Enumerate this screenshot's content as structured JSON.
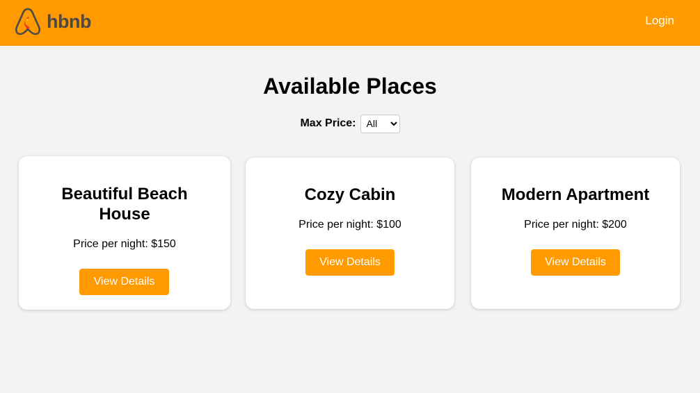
{
  "header": {
    "logo_text": "hbnb",
    "login_label": "Login"
  },
  "main": {
    "title": "Available Places",
    "filter": {
      "label": "Max Price:",
      "selected": "All"
    },
    "places": [
      {
        "name": "Beautiful Beach House",
        "price_text": "Price per night: $150",
        "button_label": "View Details"
      },
      {
        "name": "Cozy Cabin",
        "price_text": "Price per night: $100",
        "button_label": "View Details"
      },
      {
        "name": "Modern Apartment",
        "price_text": "Price per night: $200",
        "button_label": "View Details"
      }
    ]
  },
  "colors": {
    "accent": "#ff9a00",
    "background": "#f3f3f3",
    "logo_red": "#e8322a",
    "logo_gray": "#4a4a4a"
  },
  "icons": {
    "logo": "airbnb-bird-logo-icon",
    "select": "chevron-down-icon"
  }
}
